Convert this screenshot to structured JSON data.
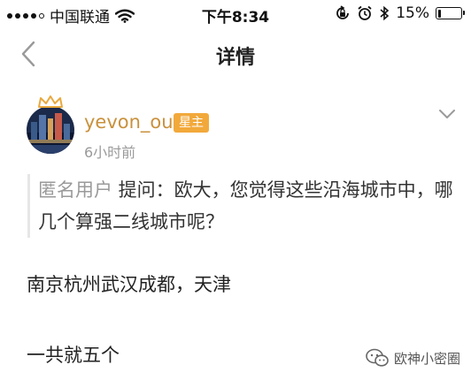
{
  "status_bar": {
    "carrier": "中国联通",
    "time": "下午8:34",
    "battery_percent": "15%",
    "battery_level": 0.15,
    "icons": [
      "signal-dots",
      "wifi-icon",
      "orientation-lock-icon",
      "alarm-icon",
      "bluetooth-icon",
      "battery-icon"
    ]
  },
  "nav": {
    "back_icon": "chevron-left-icon",
    "title": "详情"
  },
  "post": {
    "username": "yevon_ou",
    "badge": "星主",
    "timestamp": "6小时前",
    "more_icon": "chevron-down-icon",
    "question": {
      "asker": "匿名用户",
      "text": " 提问：欧大，您觉得这些沿海城市中，哪几个算强二线城市呢？"
    },
    "answer_lines": [
      "南京杭州武汉成都，天津",
      "一共就五个"
    ]
  },
  "watermark": {
    "text": "欧神小密圈",
    "icon": "wechat-icon"
  },
  "colors": {
    "username": "#c9913c",
    "badge_bg": "#f2a93b",
    "muted": "#9a9a9a"
  }
}
